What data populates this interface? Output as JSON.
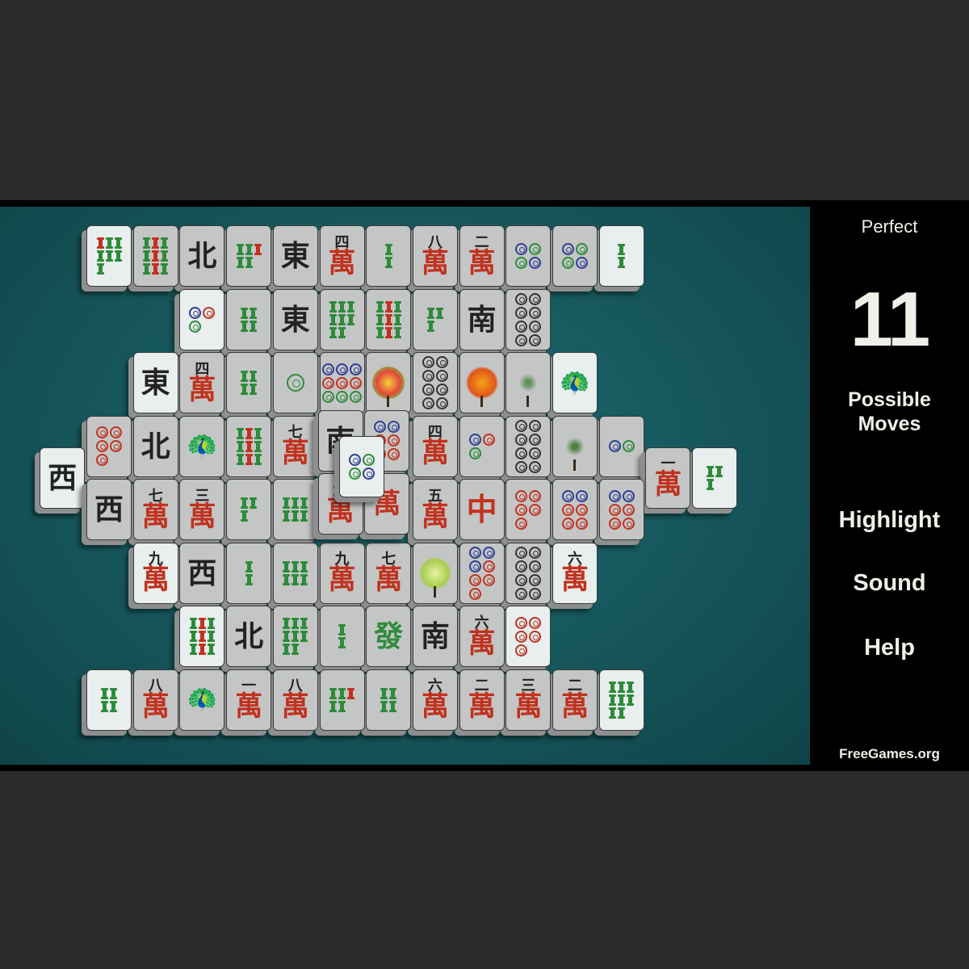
{
  "sidebar": {
    "rating": "Perfect",
    "moves_count": "11",
    "moves_label_line1": "Possible",
    "moves_label_line2": "Moves",
    "buttons": [
      "Highlight",
      "Sound",
      "Help"
    ],
    "site": "FreeGames.org"
  },
  "colors": {
    "felt": "#175a5f",
    "sidebar_bg": "#000000",
    "page_bg": "#2a2a2a",
    "wan_red": "#c0321f",
    "bamboo_green": "#2e8b3a",
    "dot_blue": "#2f3e93"
  },
  "tiles": [
    {
      "c": 0,
      "r": 0,
      "l": 0,
      "t": "bam",
      "v": 7,
      "free": true
    },
    {
      "c": 1,
      "r": 0,
      "l": 0,
      "t": "bam",
      "v": 9
    },
    {
      "c": 2,
      "r": 0,
      "l": 0,
      "t": "wind",
      "v": "北"
    },
    {
      "c": 3,
      "r": 0,
      "l": 0,
      "t": "bam",
      "v": 5
    },
    {
      "c": 4,
      "r": 0,
      "l": 0,
      "t": "wind",
      "v": "東"
    },
    {
      "c": 5,
      "r": 0,
      "l": 0,
      "t": "wan",
      "v": "四"
    },
    {
      "c": 6,
      "r": 0,
      "l": 0,
      "t": "bam",
      "v": 2
    },
    {
      "c": 7,
      "r": 0,
      "l": 0,
      "t": "wan",
      "v": "八"
    },
    {
      "c": 8,
      "r": 0,
      "l": 0,
      "t": "wan",
      "v": "二"
    },
    {
      "c": 9,
      "r": 0,
      "l": 0,
      "t": "dot",
      "v": 4
    },
    {
      "c": 10,
      "r": 0,
      "l": 0,
      "t": "dot",
      "v": 4
    },
    {
      "c": 11,
      "r": 0,
      "l": 0,
      "t": "bam",
      "v": 2,
      "free": true
    },
    {
      "c": 2,
      "r": 1,
      "l": 0,
      "t": "dot",
      "v": 3,
      "free": true
    },
    {
      "c": 3,
      "r": 1,
      "l": 0,
      "t": "bam",
      "v": 4
    },
    {
      "c": 4,
      "r": 1,
      "l": 0,
      "t": "wind",
      "v": "東"
    },
    {
      "c": 5,
      "r": 1,
      "l": 0,
      "t": "bam",
      "v": 8
    },
    {
      "c": 6,
      "r": 1,
      "l": 0,
      "t": "bam",
      "v": 9
    },
    {
      "c": 7,
      "r": 1,
      "l": 0,
      "t": "bam",
      "v": 3
    },
    {
      "c": 8,
      "r": 1,
      "l": 0,
      "t": "wind",
      "v": "南"
    },
    {
      "c": 9,
      "r": 1,
      "l": 0,
      "t": "dot",
      "v": 8
    },
    {
      "c": 1,
      "r": 2,
      "l": 0,
      "t": "wind",
      "v": "東",
      "free": true
    },
    {
      "c": 2,
      "r": 2,
      "l": 0,
      "t": "wan",
      "v": "四"
    },
    {
      "c": 3,
      "r": 2,
      "l": 0,
      "t": "bam",
      "v": 4
    },
    {
      "c": 4,
      "r": 2,
      "l": 0,
      "t": "dot",
      "v": 1
    },
    {
      "c": 5,
      "r": 2,
      "l": 0,
      "t": "dot",
      "v": 9
    },
    {
      "c": 6,
      "r": 2,
      "l": 0,
      "t": "flower",
      "v": "spring"
    },
    {
      "c": 7,
      "r": 2,
      "l": 0,
      "t": "dot",
      "v": 8
    },
    {
      "c": 8,
      "r": 2,
      "l": 0,
      "t": "flower",
      "v": "autumn"
    },
    {
      "c": 9,
      "r": 2,
      "l": 0,
      "t": "flower",
      "v": "plum"
    },
    {
      "c": 10,
      "r": 2,
      "l": 0,
      "t": "bird",
      "v": "1-bam",
      "free": true
    },
    {
      "c": 0,
      "r": 3,
      "l": 0,
      "t": "dot",
      "v": 5
    },
    {
      "c": 1,
      "r": 3,
      "l": 0,
      "t": "wind",
      "v": "北"
    },
    {
      "c": 2,
      "r": 3,
      "l": 0,
      "t": "bird",
      "v": "1-bam"
    },
    {
      "c": 3,
      "r": 3,
      "l": 0,
      "t": "bam",
      "v": 9
    },
    {
      "c": 4,
      "r": 3,
      "l": 0,
      "t": "wan",
      "v": "七"
    },
    {
      "c": 7,
      "r": 3,
      "l": 0,
      "t": "wan",
      "v": "四"
    },
    {
      "c": 8,
      "r": 3,
      "l": 0,
      "t": "dot",
      "v": 3
    },
    {
      "c": 9,
      "r": 3,
      "l": 0,
      "t": "dot",
      "v": 8
    },
    {
      "c": 10,
      "r": 3,
      "l": 0,
      "t": "flower",
      "v": "bamboo"
    },
    {
      "c": 11,
      "r": 3,
      "l": 0,
      "t": "dot",
      "v": 2
    },
    {
      "c": 0,
      "r": 4,
      "l": 0,
      "t": "wind",
      "v": "西"
    },
    {
      "c": 1,
      "r": 4,
      "l": 0,
      "t": "wan",
      "v": "七"
    },
    {
      "c": 2,
      "r": 4,
      "l": 0,
      "t": "wan",
      "v": "三"
    },
    {
      "c": 3,
      "r": 4,
      "l": 0,
      "t": "bam",
      "v": 3
    },
    {
      "c": 4,
      "r": 4,
      "l": 0,
      "t": "bam",
      "v": 6
    },
    {
      "c": 7,
      "r": 4,
      "l": 0,
      "t": "wan",
      "v": "五"
    },
    {
      "c": 8,
      "r": 4,
      "l": 0,
      "t": "dragon",
      "v": "中"
    },
    {
      "c": 9,
      "r": 4,
      "l": 0,
      "t": "dot",
      "v": 5
    },
    {
      "c": 10,
      "r": 4,
      "l": 0,
      "t": "dot",
      "v": 6
    },
    {
      "c": 11,
      "r": 4,
      "l": 0,
      "t": "dot",
      "v": 6
    },
    {
      "c": 1,
      "r": 5,
      "l": 0,
      "t": "wan",
      "v": "九",
      "free": true
    },
    {
      "c": 2,
      "r": 5,
      "l": 0,
      "t": "wind",
      "v": "西"
    },
    {
      "c": 3,
      "r": 5,
      "l": 0,
      "t": "bam",
      "v": 2
    },
    {
      "c": 4,
      "r": 5,
      "l": 0,
      "t": "bam",
      "v": 6
    },
    {
      "c": 5,
      "r": 5,
      "l": 0,
      "t": "wan",
      "v": "九"
    },
    {
      "c": 6,
      "r": 5,
      "l": 0,
      "t": "wan",
      "v": "七"
    },
    {
      "c": 7,
      "r": 5,
      "l": 0,
      "t": "flower",
      "v": "summer"
    },
    {
      "c": 8,
      "r": 5,
      "l": 0,
      "t": "dot",
      "v": 7
    },
    {
      "c": 9,
      "r": 5,
      "l": 0,
      "t": "dot",
      "v": 8
    },
    {
      "c": 10,
      "r": 5,
      "l": 0,
      "t": "wan",
      "v": "六",
      "free": true
    },
    {
      "c": 2,
      "r": 6,
      "l": 0,
      "t": "bam",
      "v": 9,
      "free": true
    },
    {
      "c": 3,
      "r": 6,
      "l": 0,
      "t": "wind",
      "v": "北"
    },
    {
      "c": 4,
      "r": 6,
      "l": 0,
      "t": "bam",
      "v": 8
    },
    {
      "c": 5,
      "r": 6,
      "l": 0,
      "t": "bam",
      "v": 2
    },
    {
      "c": 6,
      "r": 6,
      "l": 0,
      "t": "dragon",
      "v": "發"
    },
    {
      "c": 7,
      "r": 6,
      "l": 0,
      "t": "wind",
      "v": "南"
    },
    {
      "c": 8,
      "r": 6,
      "l": 0,
      "t": "wan",
      "v": "六"
    },
    {
      "c": 9,
      "r": 6,
      "l": 0,
      "t": "dot",
      "v": 5,
      "free": true
    },
    {
      "c": 0,
      "r": 7,
      "l": 0,
      "t": "bam",
      "v": 4,
      "free": true
    },
    {
      "c": 1,
      "r": 7,
      "l": 0,
      "t": "wan",
      "v": "八"
    },
    {
      "c": 2,
      "r": 7,
      "l": 0,
      "t": "bird",
      "v": "1-bam"
    },
    {
      "c": 3,
      "r": 7,
      "l": 0,
      "t": "wan",
      "v": "一"
    },
    {
      "c": 4,
      "r": 7,
      "l": 0,
      "t": "wan",
      "v": "八"
    },
    {
      "c": 5,
      "r": 7,
      "l": 0,
      "t": "bam",
      "v": 5
    },
    {
      "c": 6,
      "r": 7,
      "l": 0,
      "t": "bam",
      "v": 4
    },
    {
      "c": 7,
      "r": 7,
      "l": 0,
      "t": "wan",
      "v": "六"
    },
    {
      "c": 8,
      "r": 7,
      "l": 0,
      "t": "wan",
      "v": "二"
    },
    {
      "c": 9,
      "r": 7,
      "l": 0,
      "t": "wan",
      "v": "三"
    },
    {
      "c": 10,
      "r": 7,
      "l": 0,
      "t": "wan",
      "v": "二"
    },
    {
      "c": 11,
      "r": 7,
      "l": 0,
      "t": "bam",
      "v": 8,
      "free": true
    },
    {
      "c": -1,
      "r": 3.5,
      "l": 0,
      "t": "wind",
      "v": "西",
      "free": true
    },
    {
      "c": 12,
      "r": 3.5,
      "l": 0,
      "t": "wan",
      "v": "一"
    },
    {
      "c": 13,
      "r": 3.5,
      "l": 0,
      "t": "bam",
      "v": 3,
      "free": true
    },
    {
      "c": 5,
      "r": 3,
      "l": 1,
      "t": "wind",
      "v": "南"
    },
    {
      "c": 6,
      "r": 3,
      "l": 1,
      "t": "dot",
      "v": 6
    },
    {
      "c": 5,
      "r": 4,
      "l": 1,
      "t": "wan",
      "v": "六"
    },
    {
      "c": 6,
      "r": 4,
      "l": 1,
      "t": "wan",
      "v": "萬"
    },
    {
      "c": 5.5,
      "r": 3.5,
      "l": 2,
      "t": "dot",
      "v": 4,
      "free": true
    }
  ]
}
